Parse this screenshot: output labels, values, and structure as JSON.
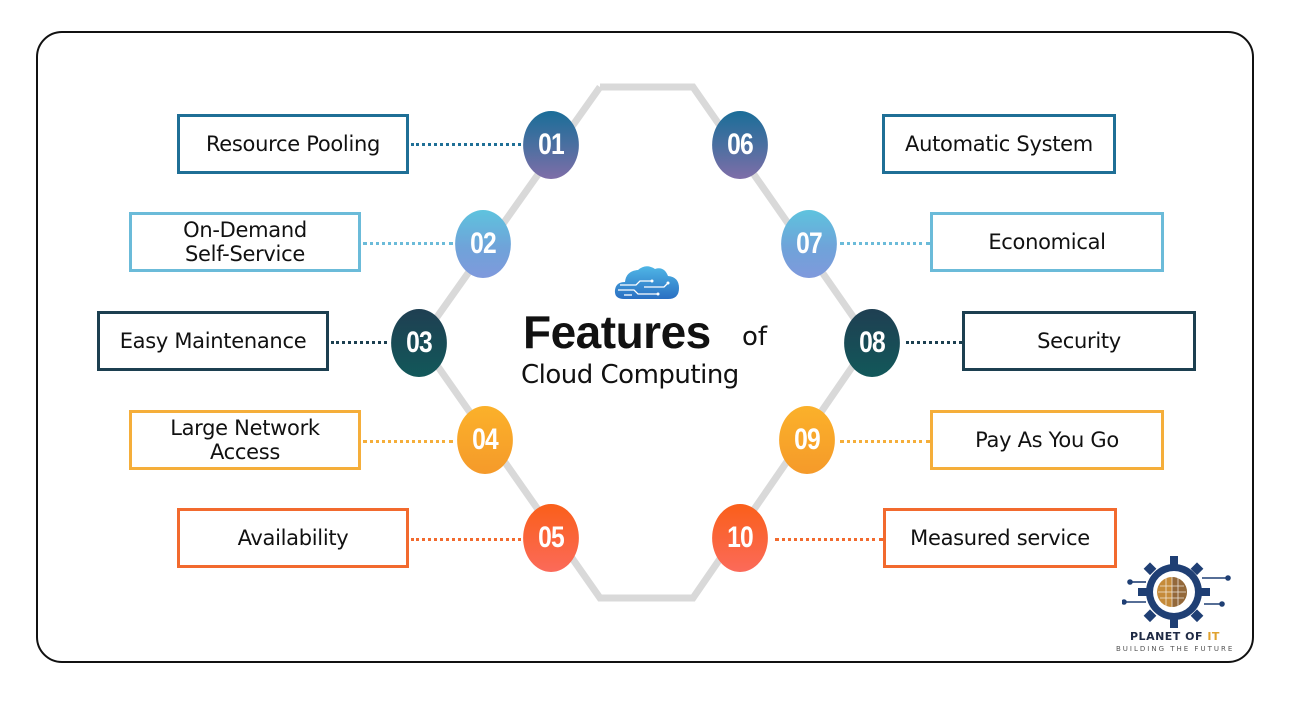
{
  "title": {
    "main": "Features",
    "of": "of",
    "sub": "Cloud Computing",
    "icon": "cloud-circuit-icon"
  },
  "colors": {
    "dark_blue": "#1f6f96",
    "light_blue": "#5fb6d9",
    "dark_teal": "#1c4a55",
    "amber": "#f5a623",
    "orange_red": "#f2622c",
    "hexagon_line": "#d9d9d9",
    "frame": "#111111"
  },
  "features": [
    {
      "number": "01",
      "label": "Resource Pooling",
      "color_key": "dark_blue"
    },
    {
      "number": "02",
      "label": "On-Demand Self-Service",
      "line1": "On-Demand",
      "line2": "Self-Service",
      "color_key": "light_blue"
    },
    {
      "number": "03",
      "label": "Easy Maintenance",
      "color_key": "dark_teal"
    },
    {
      "number": "04",
      "label": "Large Network Access",
      "line1": "Large Network",
      "line2": "Access",
      "color_key": "amber"
    },
    {
      "number": "05",
      "label": "Availability",
      "color_key": "orange_red"
    },
    {
      "number": "06",
      "label": "Automatic System",
      "color_key": "dark_blue"
    },
    {
      "number": "07",
      "label": "Economical",
      "color_key": "light_blue"
    },
    {
      "number": "08",
      "label": "Security",
      "color_key": "dark_teal"
    },
    {
      "number": "09",
      "label": "Pay As You Go",
      "color_key": "amber"
    },
    {
      "number": "10",
      "label": "Measured service",
      "color_key": "orange_red"
    }
  ],
  "logo": {
    "name_part1": "PLANET OF ",
    "name_part2": "IT",
    "tagline": "BUILDING THE FUTURE",
    "icon": "gear-globe-icon"
  }
}
